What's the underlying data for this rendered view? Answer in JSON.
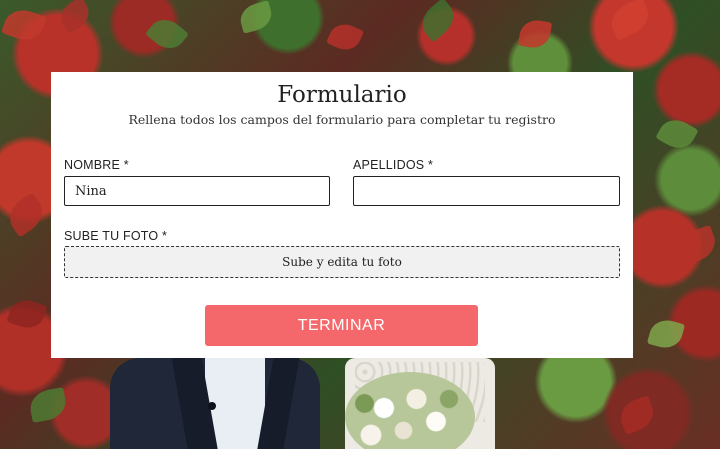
{
  "form": {
    "title": "Formulario",
    "subtitle": "Rellena todos los campos del formulario para completar tu registro",
    "fields": {
      "nombre": {
        "label": "NOMBRE *",
        "value": "Nina"
      },
      "apellidos": {
        "label": "APELLIDOS *",
        "value": ""
      },
      "foto": {
        "label": "SUBE TU FOTO *",
        "upload_text": "Sube y edita tu foto"
      }
    },
    "submit_label": "TERMINAR"
  },
  "colors": {
    "accent": "#f4686c",
    "card": "#ffffff",
    "border": "#222222"
  }
}
